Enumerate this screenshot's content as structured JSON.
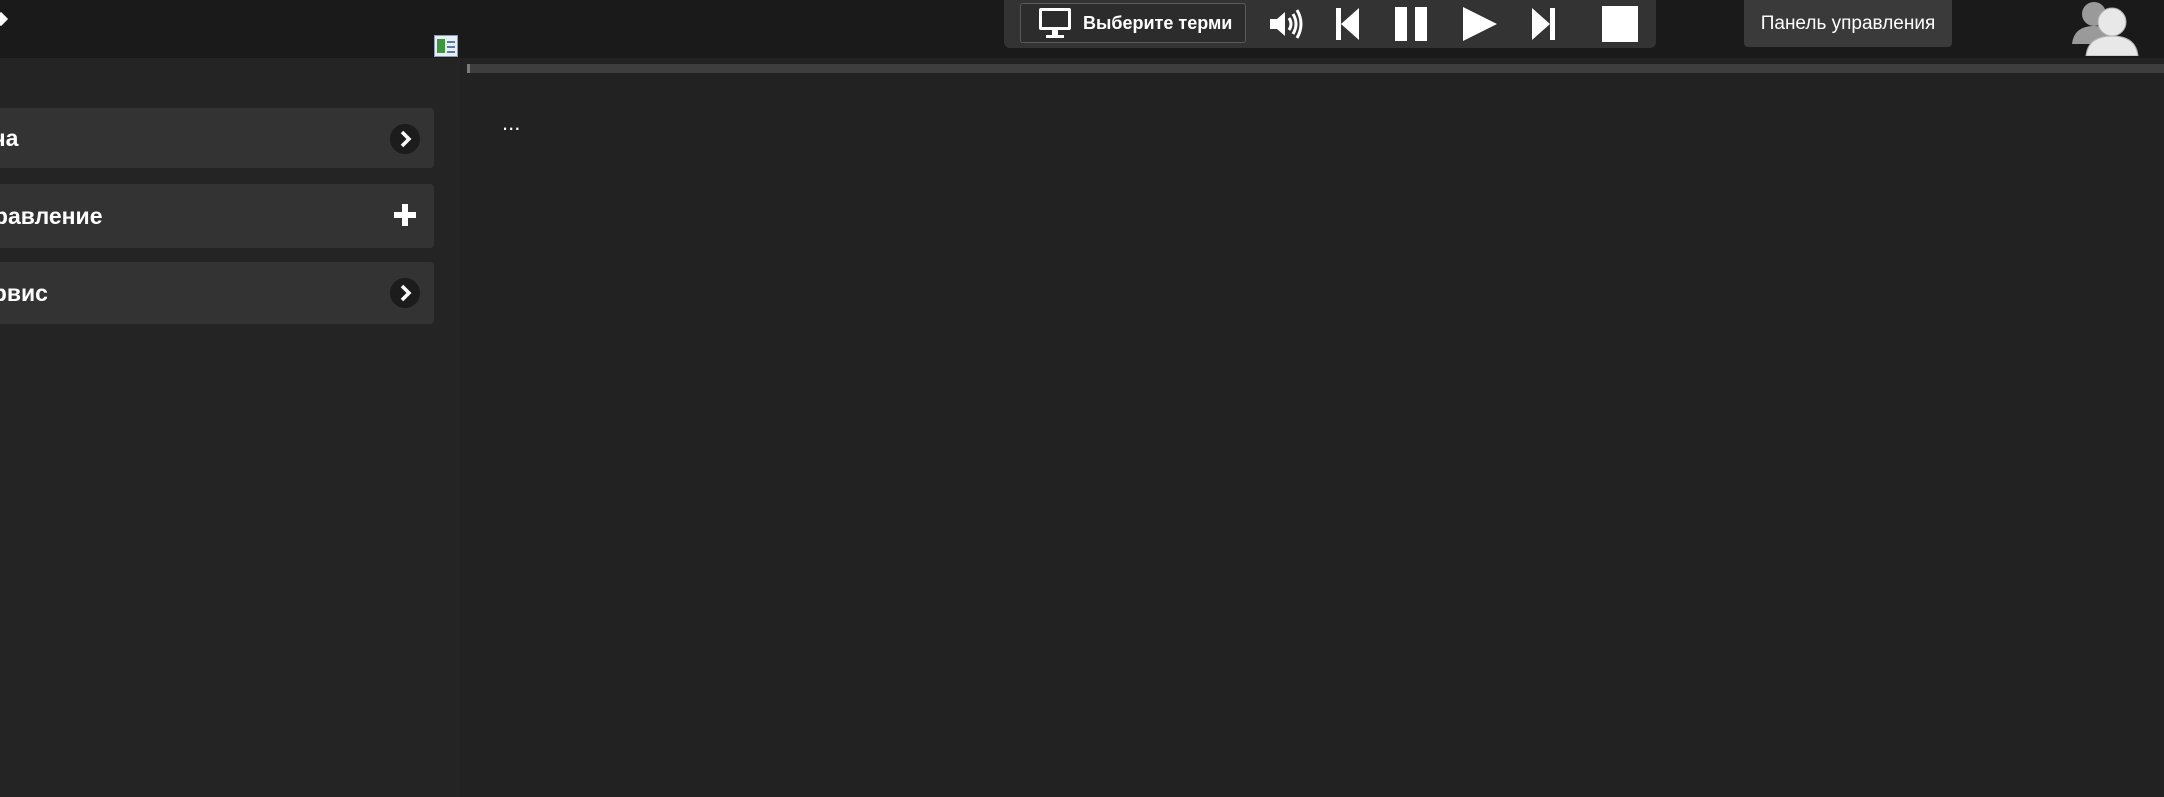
{
  "toolbar": {
    "terminal_button_label": "Выберите терми",
    "controls": [
      "volume-icon",
      "skip-back-icon",
      "pause-icon",
      "play-icon",
      "skip-forward-icon",
      "stop-icon"
    ]
  },
  "tooltip": {
    "label": "Панель управления"
  },
  "sidebar": {
    "items": [
      {
        "label": "ача",
        "icon": "chevron-right-icon"
      },
      {
        "label": "правление",
        "icon": "plus-icon"
      },
      {
        "label": "ервис",
        "icon": "chevron-right-icon"
      }
    ]
  },
  "main": {
    "placeholder_text": "...",
    "progress_fraction": 0.002
  },
  "colors": {
    "background": "#212121",
    "topbar": "#1a1a1a",
    "panel": "#333333",
    "text": "#ffffff"
  }
}
